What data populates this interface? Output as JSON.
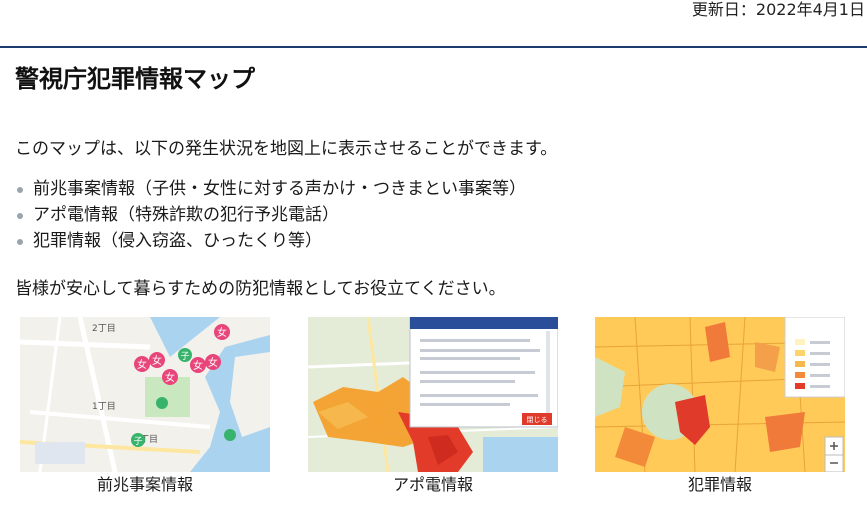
{
  "header": {
    "updated": "更新日：2022年4月1日"
  },
  "title": "警視庁犯罪情報マップ",
  "intro": "このマップは、以下の発生状況を地図上に表示させることができます。",
  "items": [
    "前兆事案情報（子供・女性に対する声かけ・つきまとい事案等）",
    "アポ電情報（特殊詐欺の犯行予兆電話）",
    "犯罪情報（侵入窃盗、ひったくり等）"
  ],
  "outro": "皆様が安心して暮らすための防犯情報としてお役立てください。",
  "maps": [
    {
      "caption": "前兆事案情報",
      "markers": {
        "woman": "女",
        "child": "子",
        "district": "2丁目",
        "district2": "1丁目",
        "district3": "丁目"
      }
    },
    {
      "caption": "アポ電情報",
      "popup_close": "閉じる"
    },
    {
      "caption": "犯罪情報"
    }
  ],
  "colors": {
    "accent_rule": "#1f3c6e",
    "woman_marker": "#e8457a",
    "child_marker": "#38b36b",
    "heat_high": "#e33b2a",
    "heat_low": "#ffd36b"
  }
}
